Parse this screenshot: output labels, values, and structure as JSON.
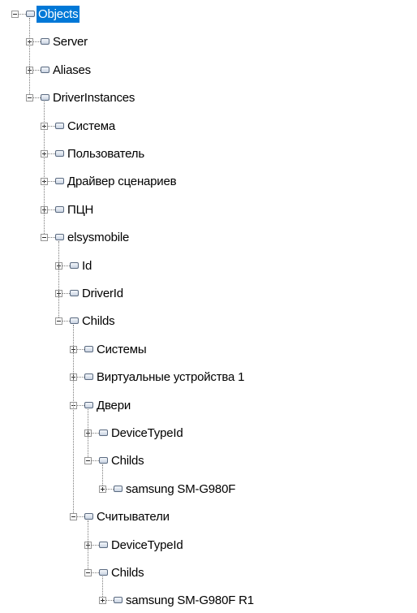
{
  "tree": [
    {
      "label": "Objects",
      "depth": 0,
      "expanded": true,
      "selected": true,
      "name": "tree-node-objects"
    },
    {
      "label": "Server",
      "depth": 1,
      "expanded": false,
      "name": "tree-node-server"
    },
    {
      "label": "Aliases",
      "depth": 1,
      "expanded": false,
      "name": "tree-node-aliases"
    },
    {
      "label": "DriverInstances",
      "depth": 1,
      "expanded": true,
      "name": "tree-node-driverinstances"
    },
    {
      "label": "Система",
      "depth": 2,
      "expanded": false,
      "name": "tree-node-sistema"
    },
    {
      "label": "Пользователь",
      "depth": 2,
      "expanded": false,
      "name": "tree-node-polzovatel"
    },
    {
      "label": "Драйвер сценариев",
      "depth": 2,
      "expanded": false,
      "name": "tree-node-drayver-stsenariev"
    },
    {
      "label": "ПЦН",
      "depth": 2,
      "expanded": false,
      "name": "tree-node-ptsn"
    },
    {
      "label": "elsysmobile",
      "depth": 2,
      "expanded": true,
      "name": "tree-node-elsysmobile"
    },
    {
      "label": "Id",
      "depth": 3,
      "expanded": false,
      "name": "tree-node-id"
    },
    {
      "label": "DriverId",
      "depth": 3,
      "expanded": false,
      "name": "tree-node-driverid"
    },
    {
      "label": "Childs",
      "depth": 3,
      "expanded": true,
      "name": "tree-node-childs"
    },
    {
      "label": "Системы",
      "depth": 4,
      "expanded": false,
      "name": "tree-node-sistemy"
    },
    {
      "label": "Виртуальные устройства 1",
      "depth": 4,
      "expanded": false,
      "name": "tree-node-virtualnye-ustroystva-1"
    },
    {
      "label": "Двери",
      "depth": 4,
      "expanded": true,
      "name": "tree-node-dveri"
    },
    {
      "label": "DeviceTypeId",
      "depth": 5,
      "expanded": false,
      "name": "tree-node-devicetypeid"
    },
    {
      "label": "Childs",
      "depth": 5,
      "expanded": true,
      "name": "tree-node-childs"
    },
    {
      "label": "samsung SM-G980F",
      "depth": 6,
      "expanded": false,
      "name": "tree-node-samsung-sm-g980f"
    },
    {
      "label": "Считыватели",
      "depth": 4,
      "expanded": true,
      "name": "tree-node-schityvateli"
    },
    {
      "label": "DeviceTypeId",
      "depth": 5,
      "expanded": false,
      "name": "tree-node-devicetypeid"
    },
    {
      "label": "Childs",
      "depth": 5,
      "expanded": true,
      "name": "tree-node-childs"
    },
    {
      "label": "samsung SM-G980F R1",
      "depth": 6,
      "expanded": false,
      "name": "tree-node-samsung-sm-g980f-r1"
    }
  ]
}
